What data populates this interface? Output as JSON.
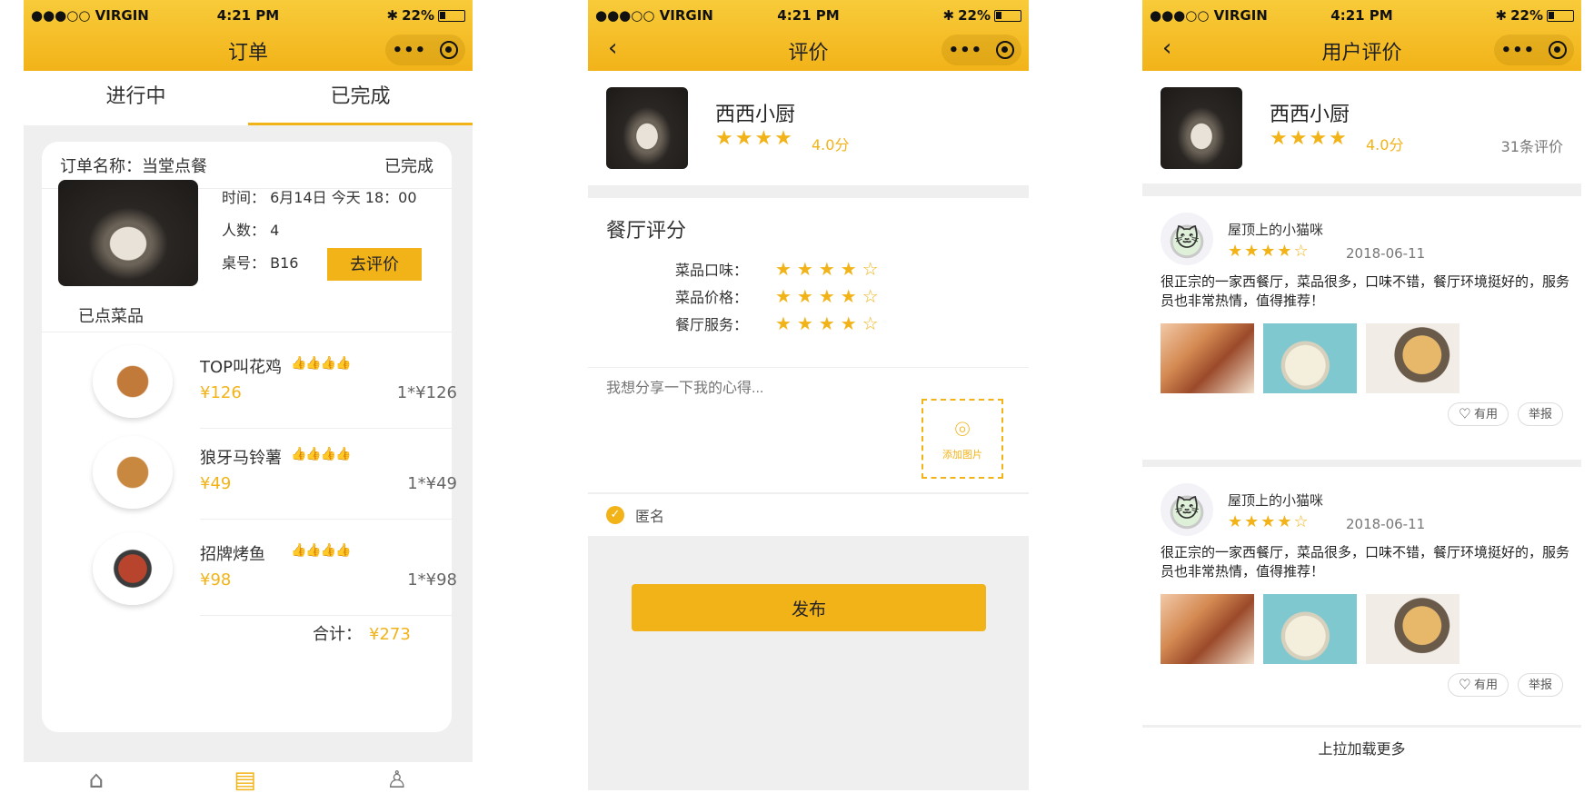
{
  "status": {
    "carrier": "●●●○○ VIRGIN",
    "time": "4:21 PM",
    "battery": "22%"
  },
  "screen1": {
    "title": "订单",
    "tabs": [
      "进行中",
      "已完成"
    ],
    "order": {
      "name": "订单名称：当堂点餐",
      "state": "已完成",
      "time": "时间：  6月14日 今天 18：00",
      "people": "人数：  4",
      "table": "桌号：  B16",
      "review_button": "去评价"
    },
    "dishes_label": "已点菜品",
    "dishes": [
      {
        "name": "TOP叫花鸡",
        "rating": "👍👍👍👍",
        "price": "¥126",
        "qty": "1*¥126"
      },
      {
        "name": "狼牙马铃薯",
        "rating": "👍👍👍👍",
        "price": "¥49",
        "qty": "1*¥49"
      },
      {
        "name": "招牌烤鱼",
        "rating": "👍👍👍👍",
        "price": "¥98",
        "qty": "1*¥98"
      }
    ],
    "total_label": "合计：",
    "total_value": "¥273",
    "nav_icons": [
      "home-icon",
      "order-icon",
      "user-icon"
    ]
  },
  "screen2": {
    "title": "评价",
    "shop_name": "西西小厨",
    "shop_stars": "★★★★",
    "shop_score": "4.0分",
    "section_title": "餐厅评分",
    "ratings": [
      {
        "label": "菜品口味：",
        "stars": "★★★★☆"
      },
      {
        "label": "菜品价格：",
        "stars": "★★★★☆"
      },
      {
        "label": "餐厅服务：",
        "stars": "★★★★☆"
      }
    ],
    "comment_placeholder": "我想分享一下我的心得...",
    "add_photo": "添加图片",
    "anonymous": "匿名",
    "publish": "发布"
  },
  "screen3": {
    "title": "用户评价",
    "shop_name": "西西小厨",
    "shop_stars": "★★★★",
    "shop_score": "4.0分",
    "review_count": "31条评价",
    "reviews": [
      {
        "user": "屋顶上的小猫咪",
        "stars": "★★★★☆",
        "date": "2018-06-11",
        "text": "很正宗的一家西餐厅，菜品很多，口味不错，餐厅环境挺好的，服务员也非常热情，值得推荐！",
        "useful": "有用",
        "report": "举报"
      },
      {
        "user": "屋顶上的小猫咪",
        "stars": "★★★★☆",
        "date": "2018-06-11",
        "text": "很正宗的一家西餐厅，菜品很多，口味不错，餐厅环境挺好的，服务员也非常热情，值得推荐！",
        "useful": "有用",
        "report": "举报"
      }
    ],
    "load_more": "上拉加载更多"
  }
}
